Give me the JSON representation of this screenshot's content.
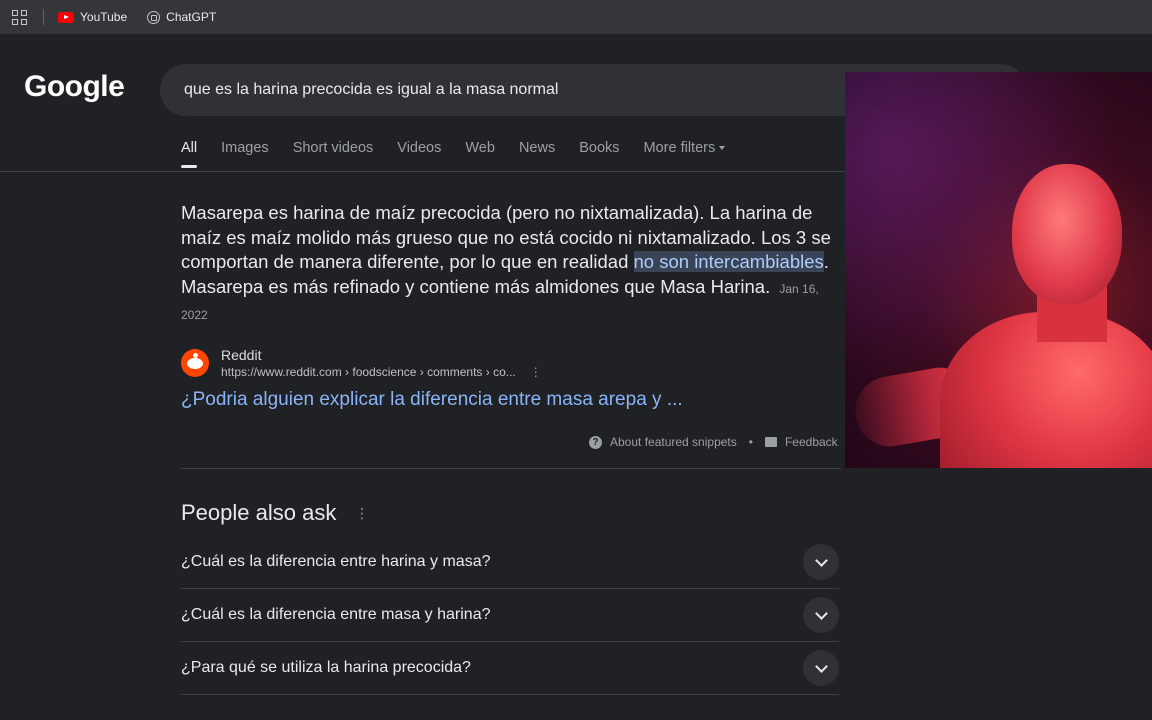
{
  "bookmarks": [
    {
      "label": "YouTube",
      "icon": "youtube-icon"
    },
    {
      "label": "ChatGPT",
      "icon": "chatgpt-icon"
    }
  ],
  "header": {
    "logo": "Google",
    "query": "que es la harina precocida es igual a la masa normal"
  },
  "tabs": {
    "all": "All",
    "images": "Images",
    "short_videos": "Short videos",
    "videos": "Videos",
    "web": "Web",
    "news": "News",
    "books": "Books",
    "more_filters": "More filters"
  },
  "snippet": {
    "text_before": "Masarepa es harina de maíz precocida (pero no nixtamalizada). La harina de maíz es maíz molido más grueso que no está cocido ni nixtamalizado. Los 3 se comportan de manera diferente, por lo que en realidad ",
    "highlight": "no son intercambiables",
    "text_after": ". Masarepa es más refinado y contiene más almidones que Masa Harina.",
    "date": "Jan 16, 2022",
    "source_name": "Reddit",
    "source_url": "https://www.reddit.com › foodscience › comments › co...",
    "link_title": "¿Podria alguien explicar la diferencia entre masa arepa y ...",
    "about": "About featured snippets",
    "feedback": "Feedback"
  },
  "paa": {
    "title": "People also ask",
    "questions": [
      "¿Cuál es la diferencia entre harina y masa?",
      "¿Cuál es la diferencia entre masa y harina?",
      "¿Para qué se utiliza la harina precocida?"
    ]
  },
  "colors": {
    "background": "#202124",
    "link": "#8ab4f8",
    "highlight_bg": "#394457"
  }
}
